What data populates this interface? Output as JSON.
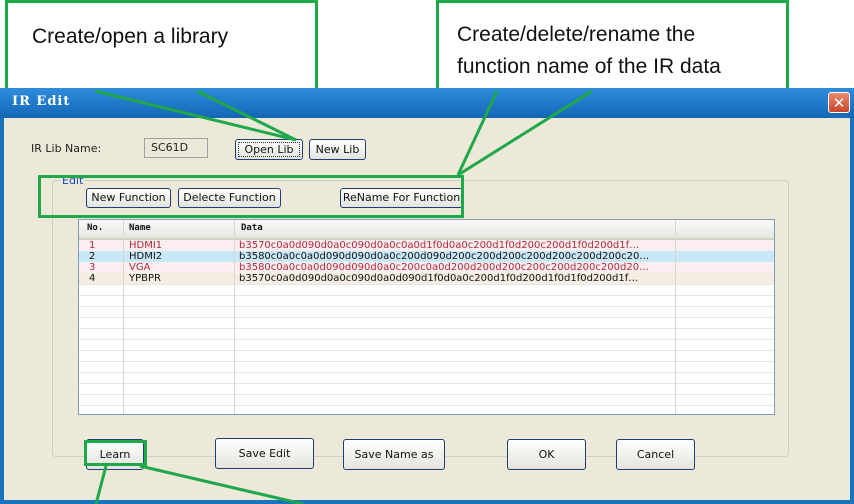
{
  "callouts": {
    "library": "Create/open a library",
    "function_line1": "Create/delete/rename the",
    "function_line2": "function name of the IR data"
  },
  "window": {
    "title": "IR Edit",
    "close_glyph": "✕"
  },
  "lib": {
    "label": "IR Lib Name:",
    "value": "SC61D",
    "open_label": "Open Lib",
    "new_label": "New Lib"
  },
  "edit_group": {
    "legend": "Edit",
    "new_function": "New Function",
    "delete_function": "Delecte Function",
    "rename_function": "ReName For Function"
  },
  "table": {
    "headers": [
      "No.",
      "Name",
      "Data"
    ],
    "rows": [
      {
        "no": "1",
        "name": "HDMI1",
        "data": "b3570c0a0d090d0a0c090d0a0c0a0d1f0d0a0c200d1f0d200c200d1f0d200d1f…",
        "bg": "#fbeef0",
        "color": "#b22a3a"
      },
      {
        "no": "2",
        "name": "HDMI2",
        "data": "b3580c0a0c0a0d090d090d0a0c200d090d200c200d200c200d200c200d200c20…",
        "bg": "#c8e8f8",
        "color": "#111111"
      },
      {
        "no": "3",
        "name": "VGA",
        "data": "b3580c0a0c0a0d090d090d0a0c200c0a0d200d200d200c200c200d200c200d20…",
        "bg": "#fbeef0",
        "color": "#b22a3a"
      },
      {
        "no": "4",
        "name": "YPBPR",
        "data": "b3570c0a0d090d0a0c090d0a0d090d1f0d0a0c200d1f0d200d1f0d1f0d200d1f…",
        "bg": "#f3ede2",
        "color": "#111111"
      }
    ]
  },
  "buttons": {
    "learn": "Learn",
    "save_edit": "Save Edit",
    "save_name_as": "Save Name as",
    "ok": "OK",
    "cancel": "Cancel"
  },
  "colors": {
    "callout_border": "#1fa84a",
    "titlebar": "#1a73bf",
    "dialog_bg": "#ece9d8"
  }
}
